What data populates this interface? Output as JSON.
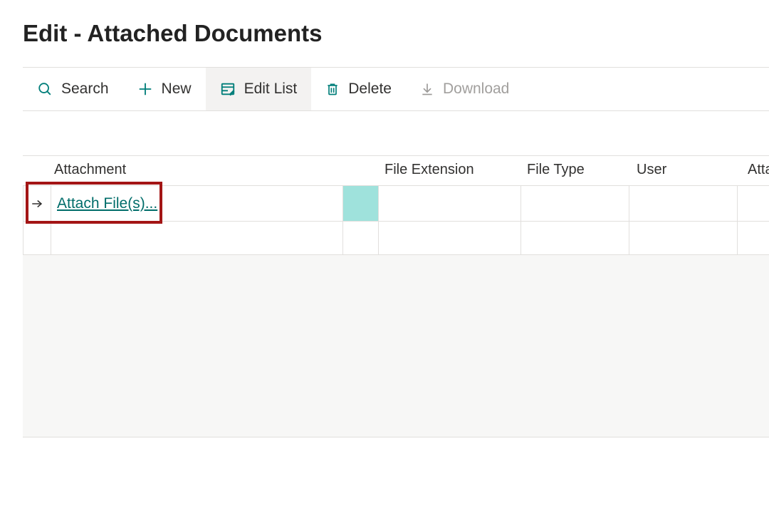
{
  "page_title": "Edit - Attached Documents",
  "toolbar": {
    "search_label": "Search",
    "new_label": "New",
    "editlist_label": "Edit List",
    "delete_label": "Delete",
    "download_label": "Download"
  },
  "table": {
    "columns": {
      "attachment": "Attachment",
      "file_extension": "File Extension",
      "file_type": "File Type",
      "user": "User",
      "attached": "Attached"
    },
    "rows": [
      {
        "attachment_action": "Attach File(s)...",
        "file_extension": "",
        "file_type": "",
        "user": "",
        "attached": ""
      },
      {
        "attachment_action": "",
        "file_extension": "",
        "file_type": "",
        "user": "",
        "attached": ""
      }
    ]
  }
}
